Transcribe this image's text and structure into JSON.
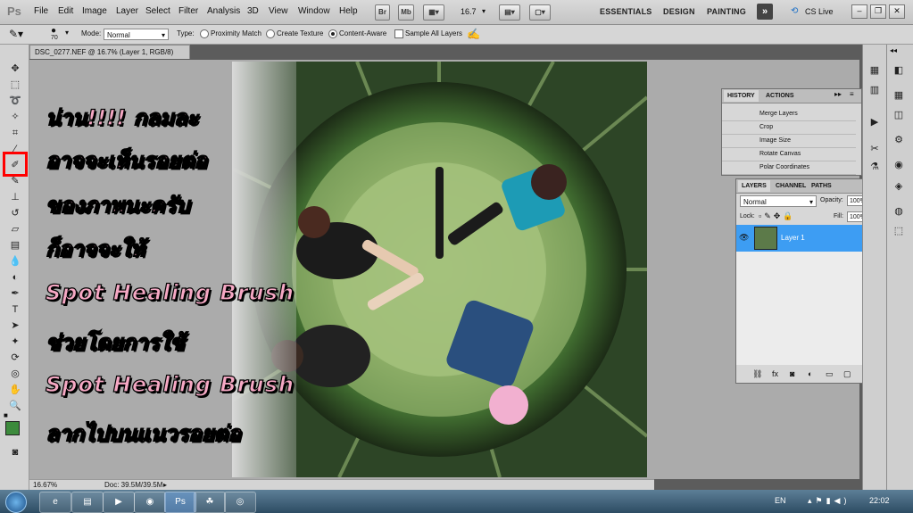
{
  "app": {
    "logo": "Ps"
  },
  "menu": [
    "File",
    "Edit",
    "Image",
    "Layer",
    "Select",
    "Filter",
    "Analysis",
    "3D",
    "View",
    "Window",
    "Help"
  ],
  "menubar_buttons": {
    "br": "Br",
    "mb": "Mb",
    "zoom": "16.7"
  },
  "workspaces": [
    "ESSENTIALS",
    "DESIGN",
    "PAINTING"
  ],
  "cslive": "CS Live",
  "options": {
    "brush_size": "70",
    "mode_label": "Mode:",
    "mode_value": "Normal",
    "type_label": "Type:",
    "proximity": "Proximity Match",
    "create_texture": "Create Texture",
    "content_aware": "Content-Aware",
    "sample_all": "Sample All Layers"
  },
  "document": {
    "tab_title": "DSC_0277.NEF @ 16.7% (Layer 1, RGB/8) *",
    "zoom": "16.67%",
    "doc_size": "Doc: 39.5M/39.5M"
  },
  "overlay_text": [
    "น่าน!!!! กลมละ",
    "อาจจะเห็นรอยต่อ",
    "ของภาพนะครับ",
    "ก็อาจจะให้",
    "Spot Healing Brush",
    "ช่วยโดยการใช้",
    "Spot Healing Brush",
    "ลากไปบนแนวรอยต่อ"
  ],
  "history_panel": {
    "tabs": [
      "HISTORY",
      "ACTIONS"
    ],
    "items": [
      "Merge Layers",
      "Crop",
      "Image Size",
      "Rotate Canvas",
      "Polar Coordinates"
    ]
  },
  "layers_panel": {
    "tabs": [
      "LAYERS",
      "CHANNEL",
      "PATHS"
    ],
    "blend_mode": "Normal",
    "opacity_label": "Opacity:",
    "opacity": "100%",
    "lock_label": "Lock:",
    "fill_label": "Fill:",
    "fill": "100%",
    "layer_name": "Layer 1"
  },
  "taskbar": {
    "lang": "EN",
    "clock": "22:02"
  },
  "colors": {
    "accent_red": "#ff0000",
    "layer_selected": "#3d9df3",
    "overlay_pink": "#f6a8c4"
  }
}
